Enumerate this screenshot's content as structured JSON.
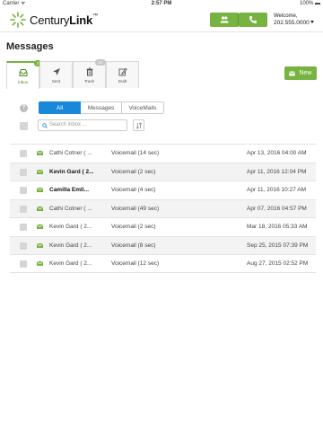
{
  "status_bar": {
    "carrier": "Carrier ᯤ",
    "time": "2:57 PM",
    "battery": "100% ▬"
  },
  "header": {
    "brand_light": "Century",
    "brand_bold": "Link",
    "brand_tm": "™",
    "welcome_label": "Welcome,",
    "phone_number": "202.555.0000",
    "accent_color": "#77b341"
  },
  "page": {
    "title": "Messages"
  },
  "tabs": [
    {
      "label": "Inbox",
      "badge": "2",
      "icon": "inbox-icon",
      "active": true
    },
    {
      "label": "Sent",
      "badge": "",
      "icon": "send-icon",
      "active": false
    },
    {
      "label": "Trash",
      "badge": "12",
      "icon": "trash-icon",
      "active": false
    },
    {
      "label": "Draft",
      "badge": "",
      "icon": "edit-icon",
      "active": false
    }
  ],
  "new_button": {
    "label": "New",
    "icon": "envelope-icon"
  },
  "filters": {
    "help": "?",
    "all": "All",
    "messages": "Messages",
    "voicemails": "VoiceMails",
    "selected": "All",
    "selected_color": "#1a88d9"
  },
  "search": {
    "placeholder": "Search inbox ..."
  },
  "messages": [
    {
      "name": "Cathi Cotner ( ...",
      "description": "Voicemail (14 sec)",
      "date": "Apr 13, 2016 04:00 AM",
      "unread": false
    },
    {
      "name": "Kevin Gard ( 2...",
      "description": "Voicemail (2 sec)",
      "date": "Apr 11, 2016 12:04 PM",
      "unread": true
    },
    {
      "name": "Camilla Emli...",
      "description": "Voicemail (4 sec)",
      "date": "Apr 11, 2016 10:27 AM",
      "unread": true
    },
    {
      "name": "Cathi Cotner ( ...",
      "description": "Voicemail (49 sec)",
      "date": "Apr 07, 2016 04:57 PM",
      "unread": false
    },
    {
      "name": "Kevin Gard ( 2...",
      "description": "Voicemail (2 sec)",
      "date": "Mar 18, 2016 05:33 AM",
      "unread": false
    },
    {
      "name": "Kevin Gard ( 2...",
      "description": "Voicemail (8 sec)",
      "date": "Sep 25, 2015 07:39 PM",
      "unread": false
    },
    {
      "name": "Kevin Gard ( 2...",
      "description": "Voicemail (12 sec)",
      "date": "Aug 27, 2015 02:52 PM",
      "unread": false
    }
  ]
}
